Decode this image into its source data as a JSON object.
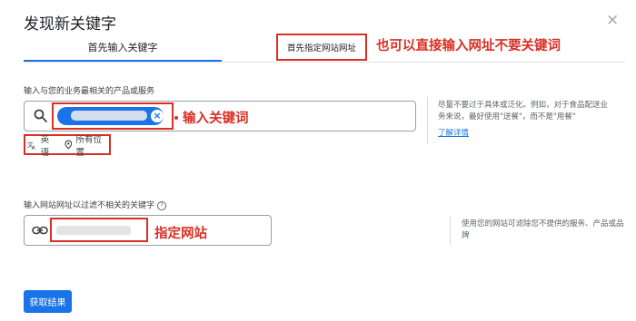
{
  "dialog": {
    "title": "发现新关键字",
    "close_label": "×"
  },
  "tabs": [
    {
      "label": "首先输入关键字",
      "active": true
    },
    {
      "label": "首先指定网站网址",
      "active": false
    }
  ],
  "annotations": {
    "tab_note": "也可以直接输入网址不要关键词",
    "keyword_note": "输入关键词",
    "url_note": "指定网站"
  },
  "keyword_section": {
    "label": "输入与您的业务最相关的产品或服务",
    "chip_remove": "×",
    "language": "英语",
    "location": "所有位置",
    "side_text": "尽量不要过于具体或泛化。例如，对于食品配送业务来说，最好使用\"送餐\"，而不是\"用餐\"",
    "side_link": "了解详情"
  },
  "url_section": {
    "label": "输入网站网址以过滤不相关的关键字",
    "help_icon": "?",
    "side_text": "使用您的网站可滤除您不提供的服务、产品或品牌"
  },
  "submit_label": "获取结果",
  "colors": {
    "accent": "#1a73e8",
    "annotation_red": "#d93025"
  },
  "icons": {
    "search": "search-icon",
    "translate": "translate-icon",
    "location": "location-pin-icon",
    "link": "link-icon",
    "close": "close-icon",
    "help": "help-icon"
  }
}
